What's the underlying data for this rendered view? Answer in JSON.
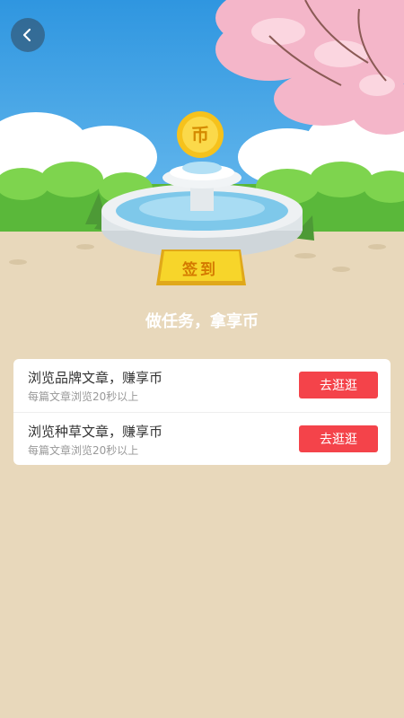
{
  "header": {
    "back_icon": "chevron-left-icon"
  },
  "scene": {
    "coin_label": "币",
    "sign_label": "签到"
  },
  "banner": {
    "title": "做任务，拿享币"
  },
  "tasks": [
    {
      "title": "浏览品牌文章，赚享币",
      "subtitle": "每篇文章浏览20秒以上",
      "button": "去逛逛"
    },
    {
      "title": "浏览种草文章，赚享币",
      "subtitle": "每篇文章浏览20秒以上",
      "button": "去逛逛"
    }
  ],
  "colors": {
    "sky": "#3fa6e8",
    "page_bg": "#e8d8bb",
    "accent_red": "#f4434a",
    "coin_gold": "#f6c21c"
  }
}
